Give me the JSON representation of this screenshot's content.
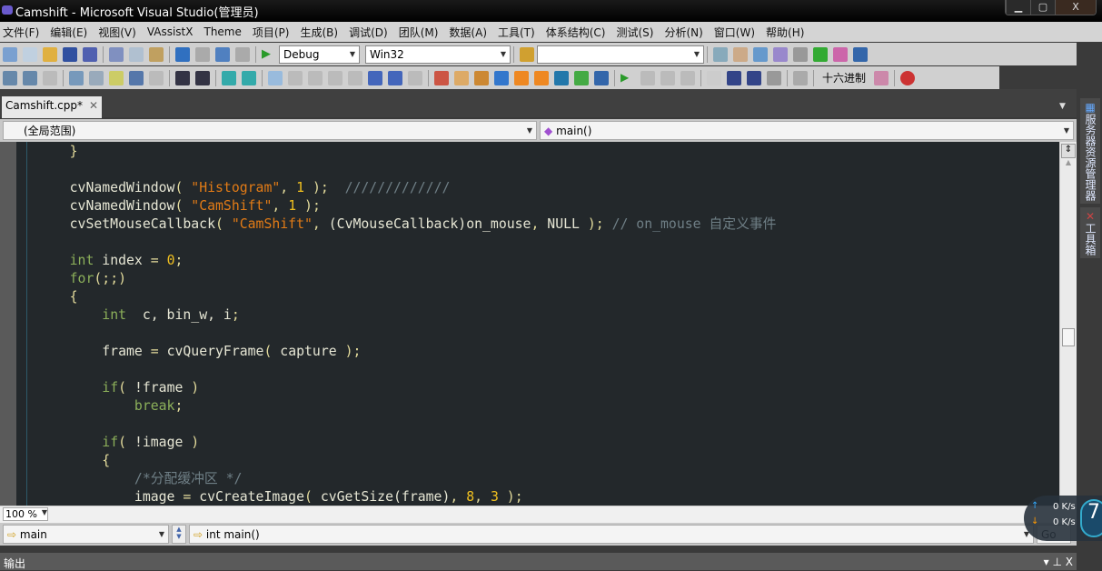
{
  "window": {
    "title": "Camshift - Microsoft Visual Studio(管理员)",
    "minimize": "▁",
    "maximize": "▢",
    "close": "X"
  },
  "menu": [
    "文件(F)",
    "编辑(E)",
    "视图(V)",
    "VAssistX",
    "Theme",
    "项目(P)",
    "生成(B)",
    "调试(D)",
    "团队(M)",
    "数据(A)",
    "工具(T)",
    "体系结构(C)",
    "测试(S)",
    "分析(N)",
    "窗口(W)",
    "帮助(H)"
  ],
  "toolbar": {
    "config": "Debug",
    "platform": "Win32",
    "find_value": "",
    "hex_label": "十六进制"
  },
  "tab": {
    "label": "Camshift.cpp*",
    "close": "✕"
  },
  "nav": {
    "scope": "(全局范围)",
    "member": "main()"
  },
  "code": [
    [
      [
        "p",
        "}"
      ]
    ],
    [],
    [
      [
        "i",
        "cvNamedWindow"
      ],
      [
        "p",
        "( "
      ],
      [
        "str",
        "\"Histogram\""
      ],
      [
        "p",
        ", "
      ],
      [
        "num",
        "1"
      ],
      [
        "p",
        " );  "
      ],
      [
        "cm",
        "/////////////"
      ]
    ],
    [
      [
        "i",
        "cvNamedWindow"
      ],
      [
        "p",
        "( "
      ],
      [
        "str",
        "\"CamShift\""
      ],
      [
        "p",
        ", "
      ],
      [
        "num",
        "1"
      ],
      [
        "p",
        " );"
      ]
    ],
    [
      [
        "i",
        "cvSetMouseCallback"
      ],
      [
        "p",
        "( "
      ],
      [
        "str",
        "\"CamShift\""
      ],
      [
        "p",
        ", "
      ],
      [
        "i",
        "(CvMouseCallback)on_mouse"
      ],
      [
        "p",
        ", "
      ],
      [
        "i",
        "NULL"
      ],
      [
        "p",
        " ); "
      ],
      [
        "cm",
        "// on_mouse 自定义事件"
      ]
    ],
    [],
    [
      [
        "kw",
        "int"
      ],
      [
        "i",
        " index "
      ],
      [
        "p",
        "= "
      ],
      [
        "num",
        "0"
      ],
      [
        "p",
        ";"
      ]
    ],
    [
      [
        "kw",
        "for"
      ],
      [
        "p",
        "(;;)"
      ]
    ],
    [
      [
        "p",
        "{"
      ]
    ],
    [
      [
        "i",
        "    "
      ],
      [
        "kw",
        "int"
      ],
      [
        "i",
        "  c, bin_w, i"
      ],
      [
        "p",
        ";"
      ]
    ],
    [],
    [
      [
        "i",
        "    frame "
      ],
      [
        "p",
        "= "
      ],
      [
        "i",
        "cvQueryFrame"
      ],
      [
        "p",
        "( "
      ],
      [
        "i",
        "capture"
      ],
      [
        "p",
        " );"
      ]
    ],
    [],
    [
      [
        "i",
        "    "
      ],
      [
        "kw",
        "if"
      ],
      [
        "p",
        "( "
      ],
      [
        "i",
        "!frame"
      ],
      [
        "p",
        " )"
      ]
    ],
    [
      [
        "i",
        "        "
      ],
      [
        "kw",
        "break"
      ],
      [
        "p",
        ";"
      ]
    ],
    [],
    [
      [
        "i",
        "    "
      ],
      [
        "kw",
        "if"
      ],
      [
        "p",
        "( "
      ],
      [
        "i",
        "!image"
      ],
      [
        "p",
        " )"
      ]
    ],
    [
      [
        "i",
        "    "
      ],
      [
        "p",
        "{"
      ]
    ],
    [
      [
        "i",
        "        "
      ],
      [
        "cm",
        "/*分配缓冲区 */"
      ]
    ],
    [
      [
        "i",
        "        image "
      ],
      [
        "p",
        "= "
      ],
      [
        "i",
        "cvCreateImage"
      ],
      [
        "p",
        "( "
      ],
      [
        "i",
        "cvGetSize(frame)"
      ],
      [
        "p",
        ", "
      ],
      [
        "num",
        "8"
      ],
      [
        "p",
        ", "
      ],
      [
        "num",
        "3"
      ],
      [
        "p",
        " );"
      ]
    ]
  ],
  "status": {
    "zoom": "100 %"
  },
  "bottomnav": {
    "left": "main",
    "right": "int main()",
    "go": "Go"
  },
  "output": {
    "title": "输出",
    "controls": "▾ ⊥ X"
  },
  "side": {
    "server_explorer": "服务器资源管理器",
    "toolbox": "工具箱"
  },
  "netmeter": {
    "up": "0 K/s",
    "down": "0 K/s",
    "badge": "7"
  }
}
